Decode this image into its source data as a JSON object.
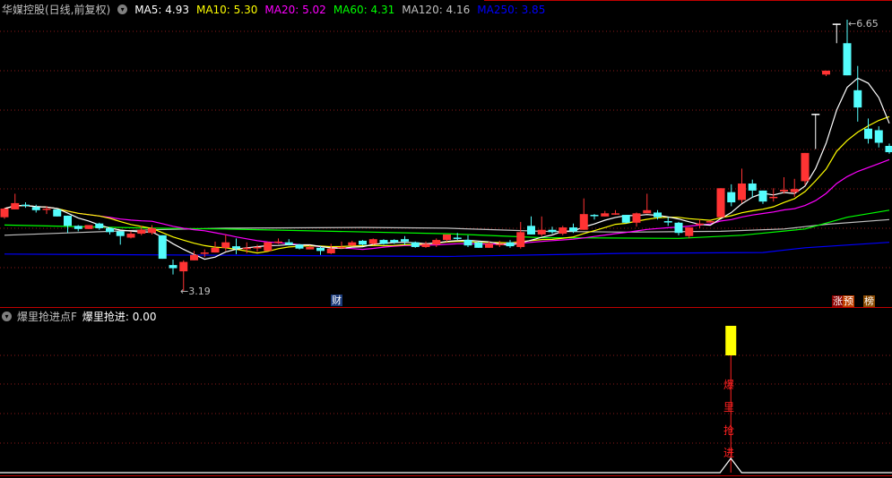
{
  "header": {
    "title": "华媒控股(日线,前复权)",
    "ma": [
      {
        "label": "MA5: 4.93",
        "color": "#ffffff"
      },
      {
        "label": "MA10: 5.30",
        "color": "#ffff00"
      },
      {
        "label": "MA20: 5.02",
        "color": "#ff00ff"
      },
      {
        "label": "MA60: 4.31",
        "color": "#00ff00"
      },
      {
        "label": "MA120: 4.16",
        "color": "#c0c0c0"
      },
      {
        "label": "MA250: 3.85",
        "color": "#0000ff"
      }
    ]
  },
  "indicator": {
    "name": "爆里抢进点F",
    "value_label": "爆里抢进: 0.00",
    "signal_text": [
      "爆",
      "里",
      "抢",
      "进"
    ],
    "signal_index": 69
  },
  "annotations": {
    "low_label": "3.19",
    "high_label": "6.65",
    "cai_tag": "财",
    "zhang_tag": "涨",
    "yu_tag": "预",
    "bang_tag": "榜"
  },
  "colors": {
    "up": "#ff3333",
    "down": "#54fcfc",
    "flat": "#ffffff",
    "grid": "#8b1a1a",
    "border": "#c00000"
  },
  "chart_data": {
    "type": "candlestick",
    "title": "华媒控股(日线,前复权)",
    "ylim": [
      3.19,
      6.65
    ],
    "ohlc": [
      [
        4.13,
        4.25,
        4.11,
        4.24
      ],
      [
        4.23,
        4.43,
        4.23,
        4.31
      ],
      [
        4.29,
        4.32,
        4.25,
        4.29
      ],
      [
        4.26,
        4.29,
        4.19,
        4.22
      ],
      [
        4.24,
        4.27,
        4.17,
        4.24
      ],
      [
        4.23,
        4.23,
        4.14,
        4.14
      ],
      [
        4.15,
        4.15,
        3.93,
        4.02
      ],
      [
        4.02,
        4.03,
        3.95,
        3.98
      ],
      [
        3.98,
        4.03,
        3.98,
        4.03
      ],
      [
        4.05,
        4.06,
        3.97,
        3.99
      ],
      [
        3.99,
        4.0,
        3.91,
        3.94
      ],
      [
        3.95,
        3.95,
        3.78,
        3.89
      ],
      [
        3.87,
        3.95,
        3.86,
        3.92
      ],
      [
        3.92,
        4.02,
        3.9,
        3.97
      ],
      [
        3.93,
        4.03,
        3.91,
        3.99
      ],
      [
        3.9,
        3.9,
        3.6,
        3.6
      ],
      [
        3.52,
        3.59,
        3.4,
        3.48
      ],
      [
        3.44,
        3.58,
        3.19,
        3.56
      ],
      [
        3.58,
        3.7,
        3.58,
        3.65
      ],
      [
        3.68,
        3.72,
        3.62,
        3.68
      ],
      [
        3.68,
        3.82,
        3.68,
        3.74
      ],
      [
        3.74,
        3.91,
        3.7,
        3.81
      ],
      [
        3.76,
        3.86,
        3.66,
        3.73
      ],
      [
        3.73,
        3.81,
        3.67,
        3.74
      ],
      [
        3.75,
        3.78,
        3.69,
        3.75
      ],
      [
        3.7,
        3.82,
        3.7,
        3.81
      ],
      [
        3.82,
        3.86,
        3.79,
        3.82
      ],
      [
        3.81,
        3.85,
        3.77,
        3.78
      ],
      [
        3.78,
        3.79,
        3.72,
        3.73
      ],
      [
        3.72,
        3.77,
        3.72,
        3.75
      ],
      [
        3.74,
        3.76,
        3.65,
        3.7
      ],
      [
        3.67,
        3.79,
        3.66,
        3.73
      ],
      [
        3.75,
        3.82,
        3.73,
        3.75
      ],
      [
        3.77,
        3.83,
        3.76,
        3.81
      ],
      [
        3.83,
        3.84,
        3.77,
        3.78
      ],
      [
        3.79,
        3.86,
        3.78,
        3.85
      ],
      [
        3.84,
        3.85,
        3.78,
        3.79
      ],
      [
        3.84,
        3.85,
        3.79,
        3.81
      ],
      [
        3.85,
        3.89,
        3.78,
        3.82
      ],
      [
        3.81,
        3.82,
        3.74,
        3.75
      ],
      [
        3.75,
        3.82,
        3.74,
        3.79
      ],
      [
        3.78,
        3.86,
        3.75,
        3.84
      ],
      [
        3.84,
        3.91,
        3.82,
        3.91
      ],
      [
        3.87,
        3.93,
        3.84,
        3.87
      ],
      [
        3.84,
        3.9,
        3.75,
        3.77
      ],
      [
        3.81,
        3.82,
        3.74,
        3.74
      ],
      [
        3.74,
        3.82,
        3.74,
        3.79
      ],
      [
        3.79,
        3.83,
        3.75,
        3.79
      ],
      [
        3.81,
        3.84,
        3.74,
        3.76
      ],
      [
        3.75,
        4.07,
        3.73,
        3.94
      ],
      [
        4.02,
        4.14,
        3.91,
        3.91
      ],
      [
        3.91,
        4.14,
        3.89,
        3.97
      ],
      [
        3.97,
        4.01,
        3.92,
        3.94
      ],
      [
        3.92,
        4.02,
        3.9,
        4.0
      ],
      [
        4.0,
        4.05,
        3.93,
        3.95
      ],
      [
        3.97,
        4.37,
        3.97,
        4.17
      ],
      [
        4.16,
        4.17,
        4.1,
        4.16
      ],
      [
        4.14,
        4.21,
        4.14,
        4.18
      ],
      [
        4.18,
        4.22,
        4.16,
        4.18
      ],
      [
        4.16,
        4.16,
        4.05,
        4.06
      ],
      [
        4.06,
        4.19,
        4.01,
        4.18
      ],
      [
        4.18,
        4.43,
        4.18,
        4.22
      ],
      [
        4.19,
        4.22,
        4.1,
        4.13
      ],
      [
        4.08,
        4.13,
        4.02,
        4.08
      ],
      [
        4.06,
        4.07,
        3.9,
        3.93
      ],
      [
        3.89,
        4.0,
        3.86,
        4.0
      ],
      [
        4.05,
        4.1,
        3.99,
        4.05
      ],
      [
        4.08,
        4.09,
        4.06,
        4.08
      ],
      [
        4.13,
        4.5,
        4.13,
        4.5
      ],
      [
        4.45,
        4.55,
        4.27,
        4.32
      ],
      [
        4.35,
        4.75,
        4.31,
        4.56
      ],
      [
        4.56,
        4.61,
        4.38,
        4.47
      ],
      [
        4.47,
        4.47,
        4.3,
        4.33
      ],
      [
        4.39,
        4.5,
        4.33,
        4.39
      ],
      [
        4.46,
        4.64,
        4.43,
        4.48
      ],
      [
        4.45,
        4.62,
        4.39,
        4.49
      ],
      [
        4.59,
        4.95,
        4.54,
        4.95
      ],
      [
        5.45,
        5.45,
        5.0,
        5.45
      ],
      [
        5.95,
        6.0,
        5.93,
        6.0
      ],
      [
        6.6,
        6.6,
        6.35,
        6.6
      ],
      [
        6.35,
        6.65,
        5.94,
        5.94
      ],
      [
        5.75,
        6.06,
        5.35,
        5.53
      ],
      [
        5.26,
        5.39,
        5.07,
        5.13
      ],
      [
        5.24,
        5.29,
        5.02,
        5.08
      ],
      [
        5.04,
        5.07,
        4.94,
        4.96
      ]
    ],
    "ma_long": {
      "MA60": [
        [
          0,
          4.03
        ],
        [
          14,
          3.99
        ],
        [
          21,
          3.98
        ],
        [
          42,
          3.92
        ],
        [
          51,
          3.87
        ],
        [
          64,
          3.86
        ],
        [
          70,
          3.9
        ],
        [
          76,
          3.98
        ],
        [
          80,
          4.13
        ],
        [
          84,
          4.22
        ]
      ],
      "MA120": [
        [
          0,
          3.9
        ],
        [
          6,
          3.93
        ],
        [
          14,
          3.97
        ],
        [
          21,
          3.99
        ],
        [
          34,
          4.0
        ],
        [
          42,
          3.99
        ],
        [
          51,
          3.95
        ],
        [
          59,
          3.94
        ],
        [
          68,
          3.95
        ],
        [
          74,
          3.98
        ],
        [
          78,
          4.04
        ],
        [
          84,
          4.1
        ]
      ],
      "MA250": [
        [
          0,
          3.66
        ],
        [
          42,
          3.63
        ],
        [
          59,
          3.67
        ],
        [
          72,
          3.68
        ],
        [
          76,
          3.74
        ],
        [
          84,
          3.81
        ]
      ]
    },
    "indicator_signal": {
      "index": 69,
      "value": 1
    }
  }
}
